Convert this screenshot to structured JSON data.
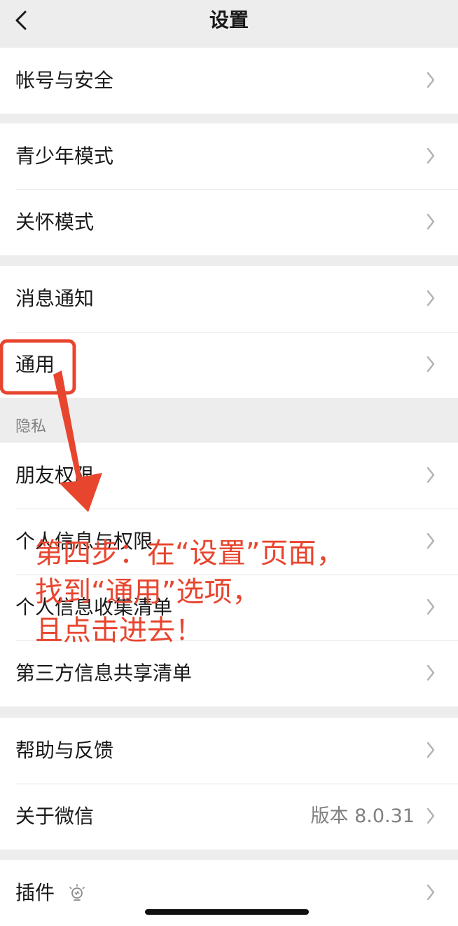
{
  "header": {
    "title": "设置",
    "back_icon": "chevron-left-icon"
  },
  "groups": [
    {
      "items": [
        {
          "label": "帐号与安全"
        }
      ]
    },
    {
      "items": [
        {
          "label": "青少年模式"
        },
        {
          "label": "关怀模式"
        }
      ]
    },
    {
      "items": [
        {
          "label": "消息通知"
        },
        {
          "label": "通用"
        }
      ]
    },
    {
      "section": "隐私",
      "items": [
        {
          "label": "朋友权限"
        },
        {
          "label": "个人信息与权限"
        },
        {
          "label": "个人信息收集清单"
        },
        {
          "label": "第三方信息共享清单"
        }
      ]
    },
    {
      "items": [
        {
          "label": "帮助与反馈"
        },
        {
          "label": "关于微信",
          "value": "版本 8.0.31"
        }
      ]
    },
    {
      "items": [
        {
          "label": "插件",
          "icon": "lightbulb-icon"
        }
      ]
    }
  ],
  "annotation": {
    "lines": [
      "第四步：在“设置”页面，",
      "找到“通用”选项，",
      "且点击进去！"
    ],
    "color": "#e8452e"
  },
  "colors": {
    "background": "#ededed",
    "cell": "#ffffff",
    "divider": "#e5e5e5",
    "secondary_text": "#808080"
  }
}
